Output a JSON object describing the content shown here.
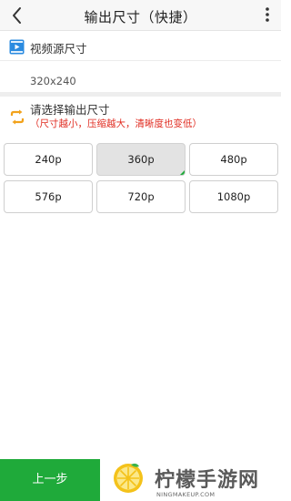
{
  "header": {
    "title": "输出尺寸（快捷）",
    "back_icon": "chevron-left-icon",
    "more_icon": "more-vertical-icon"
  },
  "source": {
    "icon": "video-play-icon",
    "label": "视频源尺寸",
    "value": "320x240"
  },
  "output": {
    "icon": "convert-arrows-icon",
    "label": "请选择输出尺寸",
    "hint": "（尺寸越小，压缩越大，清晰度也变低）",
    "options": [
      {
        "label": "240p",
        "selected": false
      },
      {
        "label": "360p",
        "selected": true
      },
      {
        "label": "480p",
        "selected": false
      },
      {
        "label": "576p",
        "selected": false
      },
      {
        "label": "720p",
        "selected": false
      },
      {
        "label": "1080p",
        "selected": false
      }
    ]
  },
  "footer": {
    "prev_label": "上一步",
    "brand_text": "柠檬手游网",
    "brand_sub": "NINGMAKEUP.COM"
  },
  "colors": {
    "accent_green": "#1faa3a",
    "hint_red": "#e02b20",
    "source_icon_blue": "#2b8be0",
    "output_icon_orange": "#f2a21b"
  }
}
